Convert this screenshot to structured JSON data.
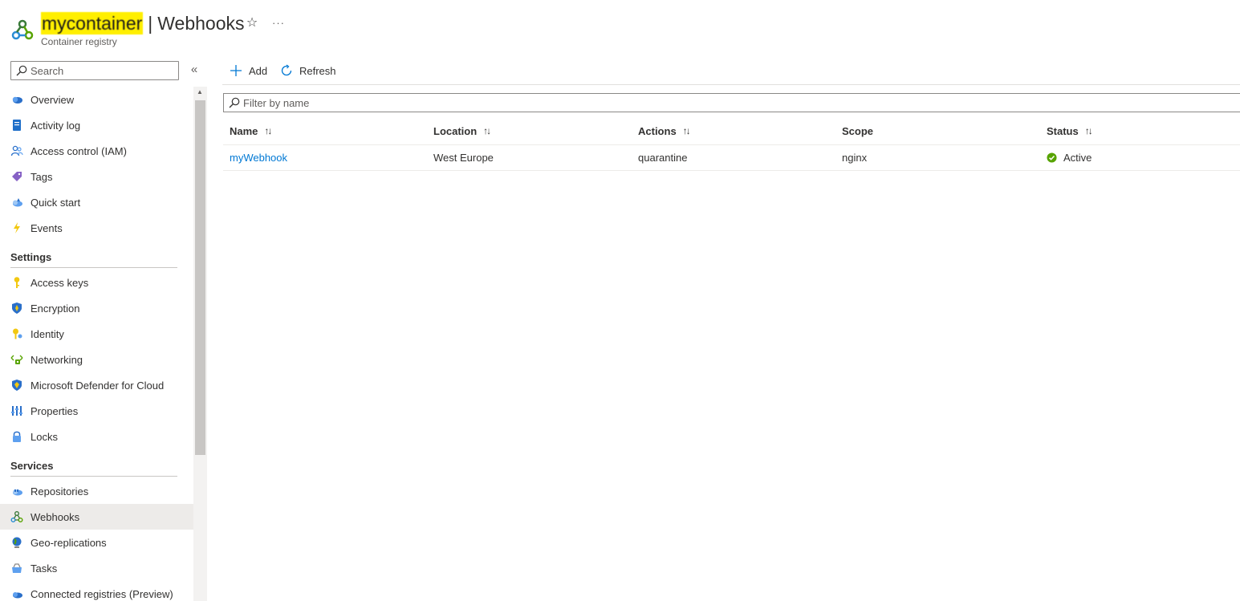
{
  "header": {
    "resource_name": "mycontainer",
    "separator": "|",
    "page_title": "Webhooks",
    "subtitle": "Container registry",
    "more_label": "···",
    "star_label": "☆"
  },
  "sidebar": {
    "search_placeholder": "Search",
    "collapse_label": "«",
    "groups": {
      "top": [
        {
          "label": "Overview",
          "icon": "cloud-icon"
        },
        {
          "label": "Activity log",
          "icon": "activity-log-icon"
        },
        {
          "label": "Access control (IAM)",
          "icon": "people-icon"
        },
        {
          "label": "Tags",
          "icon": "tag-icon"
        },
        {
          "label": "Quick start",
          "icon": "quickstart-icon"
        },
        {
          "label": "Events",
          "icon": "lightning-icon"
        }
      ],
      "settings_title": "Settings",
      "settings": [
        {
          "label": "Access keys",
          "icon": "key-icon"
        },
        {
          "label": "Encryption",
          "icon": "shield-icon"
        },
        {
          "label": "Identity",
          "icon": "identity-icon"
        },
        {
          "label": "Networking",
          "icon": "networking-icon"
        },
        {
          "label": "Microsoft Defender for Cloud",
          "icon": "defender-icon"
        },
        {
          "label": "Properties",
          "icon": "properties-icon"
        },
        {
          "label": "Locks",
          "icon": "lock-icon"
        }
      ],
      "services_title": "Services",
      "services": [
        {
          "label": "Repositories",
          "icon": "repositories-icon"
        },
        {
          "label": "Webhooks",
          "icon": "webhook-icon",
          "selected": true
        },
        {
          "label": "Geo-replications",
          "icon": "globe-icon"
        },
        {
          "label": "Tasks",
          "icon": "tasks-icon"
        },
        {
          "label": "Connected registries (Preview)",
          "icon": "connected-registries-icon"
        }
      ]
    }
  },
  "toolbar": {
    "add_label": "Add",
    "refresh_label": "Refresh"
  },
  "filter": {
    "placeholder": "Filter by name"
  },
  "table": {
    "columns": [
      "Name",
      "Location",
      "Actions",
      "Scope",
      "Status"
    ],
    "sortable": [
      true,
      true,
      true,
      false,
      true
    ],
    "sort_glyph": "↑↓",
    "rows": [
      {
        "name": "myWebhook",
        "location": "West Europe",
        "actions": "quarantine",
        "scope": "nginx",
        "status": "Active"
      }
    ]
  },
  "colors": {
    "accent": "#0078d4",
    "status_active": "#57a300",
    "highlight": "#ffef00",
    "selected_bg": "#edebe9"
  }
}
